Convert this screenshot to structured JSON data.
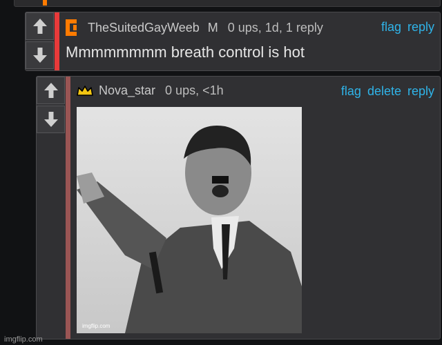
{
  "comments": [
    {
      "username": "TheSuitedGayWeeb",
      "tag": "M",
      "stats": "0 ups, 1d, 1 reply",
      "actions": [
        "flag",
        "reply"
      ],
      "text": "Mmmmmmmm breath control is hot",
      "accent_color": "#e83a3a",
      "icon": "orange-bracket-icon"
    },
    {
      "username": "Nova_star",
      "stats": "0 ups, <1h",
      "actions": [
        "flag",
        "delete",
        "reply"
      ],
      "accent_color": "#9a5554",
      "icon": "crown-icon",
      "image_watermark": "imgflip.com"
    }
  ],
  "screenshot_watermark": "imgflip.com",
  "colors": {
    "link": "#2fb4e9",
    "background": "#111214",
    "comment_bg": "#303033"
  }
}
